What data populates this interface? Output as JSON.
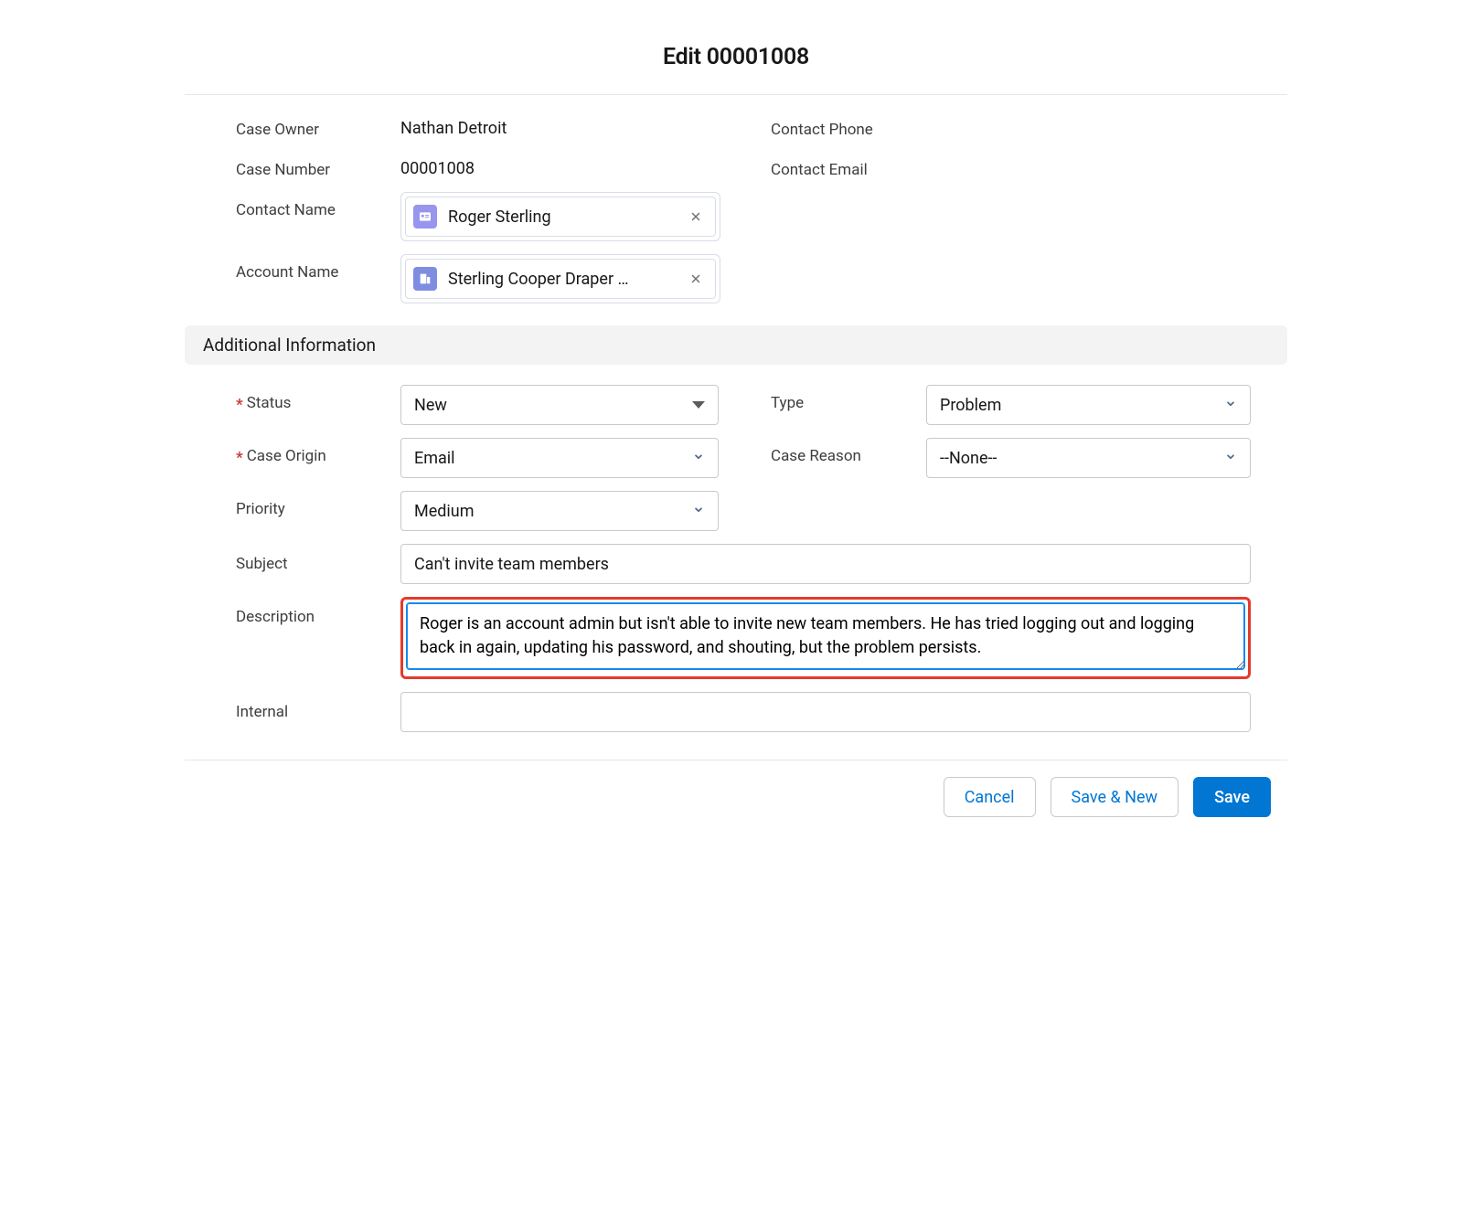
{
  "modal": {
    "title": "Edit 00001008"
  },
  "basic": {
    "case_owner_label": "Case Owner",
    "case_owner_value": "Nathan Detroit",
    "case_number_label": "Case Number",
    "case_number_value": "00001008",
    "contact_name_label": "Contact Name",
    "contact_name_value": "Roger Sterling",
    "account_name_label": "Account Name",
    "account_name_value": "Sterling Cooper Draper …",
    "contact_phone_label": "Contact Phone",
    "contact_phone_value": "",
    "contact_email_label": "Contact Email",
    "contact_email_value": ""
  },
  "section": {
    "additional_info": "Additional Information"
  },
  "addl": {
    "status_label": "Status",
    "status_value": "New",
    "type_label": "Type",
    "type_value": "Problem",
    "case_origin_label": "Case Origin",
    "case_origin_value": "Email",
    "case_reason_label": "Case Reason",
    "case_reason_value": "--None--",
    "priority_label": "Priority",
    "priority_value": "Medium",
    "subject_label": "Subject",
    "subject_value": "Can't invite team members",
    "description_label": "Description",
    "description_value": "Roger is an account admin but isn't able to invite new team members. He has tried logging out and logging back in again, updating his password, and shouting, but the problem persists.",
    "internal_label": "Internal",
    "internal_value": ""
  },
  "footer": {
    "cancel": "Cancel",
    "save_new": "Save & New",
    "save": "Save"
  }
}
